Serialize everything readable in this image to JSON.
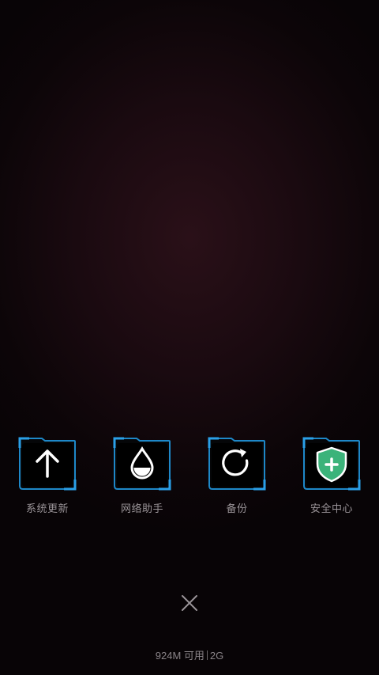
{
  "tools": [
    {
      "label": "系统更新",
      "icon": "arrow-up-icon"
    },
    {
      "label": "网络助手",
      "icon": "water-drop-icon"
    },
    {
      "label": "备份",
      "icon": "refresh-icon"
    },
    {
      "label": "安全中心",
      "icon": "shield-plus-icon"
    }
  ],
  "close": {
    "icon": "close-icon"
  },
  "status": {
    "memory": "924M 可用",
    "network": "2G"
  },
  "colors": {
    "frame_accent": "#1e88c8",
    "frame_dark": "#0d3a5c",
    "shield_green": "#3bb37a",
    "label_gray": "#9a9498"
  }
}
